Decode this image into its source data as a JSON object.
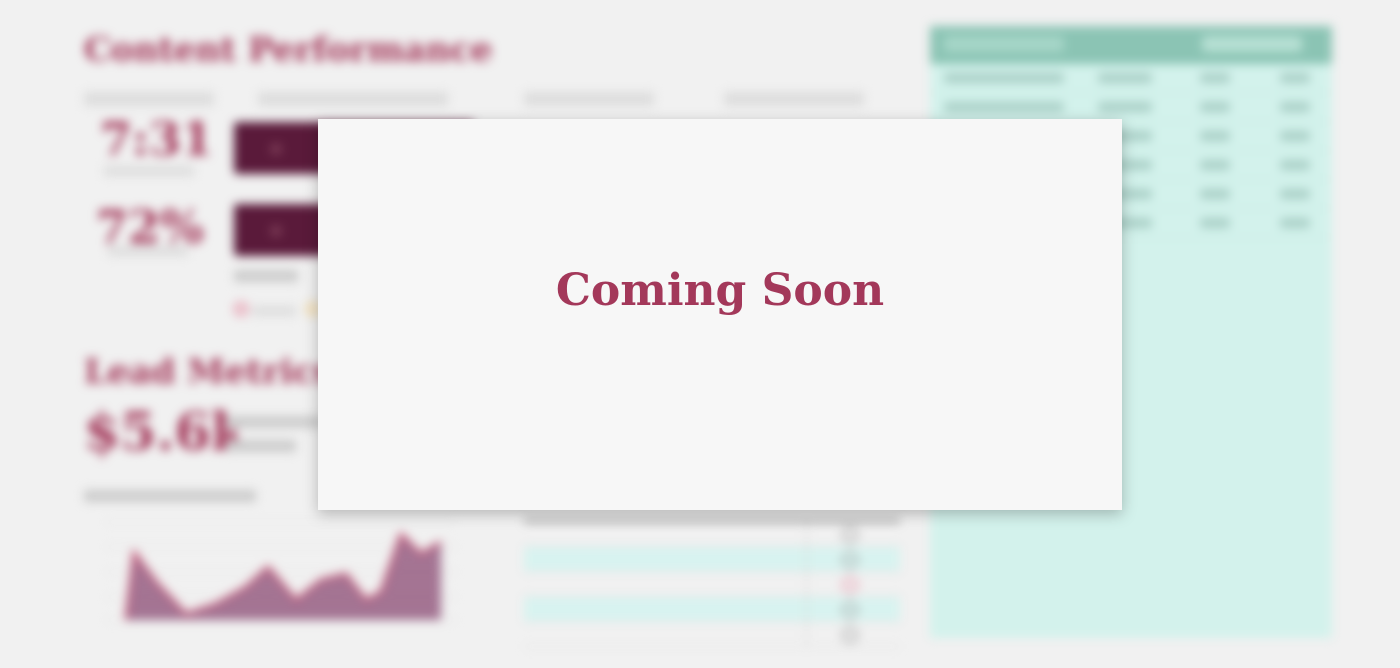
{
  "modal": {
    "title": "Coming Soon"
  },
  "background": {
    "section1_title": "Content Performance",
    "section1_labels": [
      "",
      "",
      "",
      ""
    ],
    "stat1_value": "7:31",
    "stat2_value": "72%",
    "section2_title": "Lead Metrics",
    "lead_value": "$5.6k",
    "accent_color": "#a3385a",
    "panel_color": "#d3f2ec"
  }
}
